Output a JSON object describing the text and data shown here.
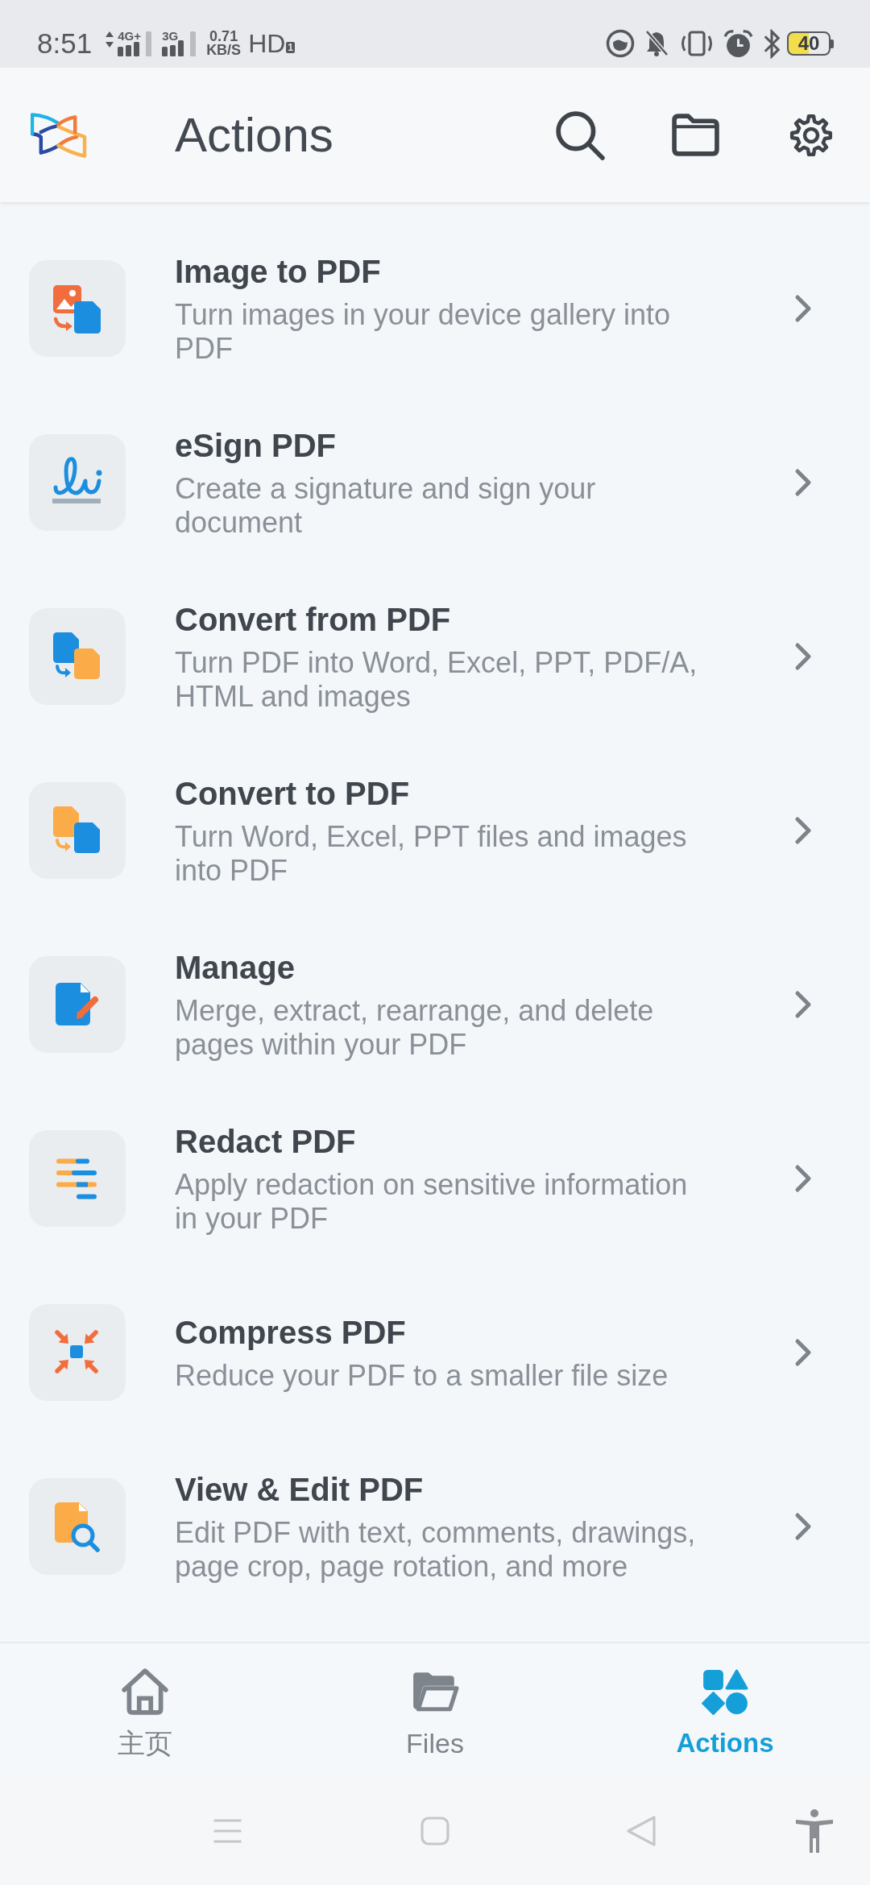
{
  "status_bar": {
    "time": "8:51",
    "sim_1_network": "4G+",
    "sim_2_network": "3G",
    "speed_value": "0.71",
    "speed_unit": "KB/S",
    "hd_label": "HD",
    "hd_sim": "1",
    "battery": "40"
  },
  "header": {
    "title": "Actions"
  },
  "actions": [
    {
      "title": "Image to PDF",
      "description": "Turn images in your device gallery into PDF"
    },
    {
      "title": "eSign PDF",
      "description": "Create a signature and sign your document"
    },
    {
      "title": "Convert from PDF",
      "description": "Turn PDF into Word, Excel, PPT, PDF/A, HTML and images"
    },
    {
      "title": "Convert to PDF",
      "description": "Turn Word, Excel, PPT files and images into PDF"
    },
    {
      "title": "Manage",
      "description": "Merge, extract, rearrange, and delete pages within your PDF"
    },
    {
      "title": "Redact PDF",
      "description": "Apply redaction on sensitive information in your PDF"
    },
    {
      "title": "Compress PDF",
      "description": "Reduce your PDF to a smaller file size"
    },
    {
      "title": "View & Edit PDF",
      "description": "Edit PDF with text, comments, drawings, page crop, page rotation, and more"
    }
  ],
  "bottom_nav": {
    "tabs": [
      {
        "label": "主页",
        "selected": false
      },
      {
        "label": "Files",
        "selected": false
      },
      {
        "label": "Actions",
        "selected": true
      }
    ]
  }
}
